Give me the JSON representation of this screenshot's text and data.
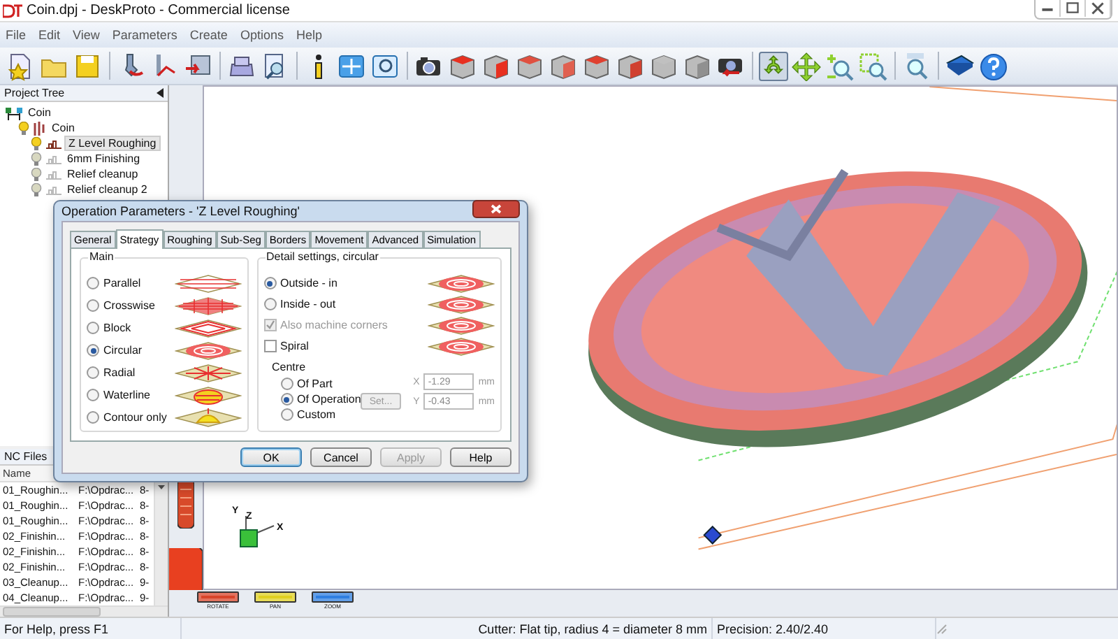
{
  "window": {
    "title": "Coin.dpj - DeskProto - Commercial license"
  },
  "menu": [
    "File",
    "Edit",
    "View",
    "Parameters",
    "Create",
    "Options",
    "Help"
  ],
  "project_tree": {
    "title": "Project Tree",
    "items": [
      {
        "label": "Coin",
        "kind": "project",
        "children": [
          {
            "label": "Coin",
            "kind": "part",
            "lit": true,
            "selected": false,
            "children": [
              {
                "label": "Z Level Roughing",
                "kind": "operation",
                "lit": true,
                "selected": true
              },
              {
                "label": "6mm Finishing",
                "kind": "operation",
                "lit": false,
                "selected": false
              },
              {
                "label": "Relief cleanup",
                "kind": "operation",
                "lit": false,
                "selected": false
              },
              {
                "label": "Relief cleanup 2",
                "kind": "operation",
                "lit": false,
                "selected": false
              }
            ]
          }
        ]
      }
    ]
  },
  "nc_files": {
    "title": "NC Files",
    "columns": [
      "Name"
    ],
    "rows": [
      [
        "01_Roughin...",
        "F:\\Opdrac...",
        "8-"
      ],
      [
        "01_Roughin...",
        "F:\\Opdrac...",
        "8-"
      ],
      [
        "01_Roughin...",
        "F:\\Opdrac...",
        "8-"
      ],
      [
        "02_Finishin...",
        "F:\\Opdrac...",
        "8-"
      ],
      [
        "02_Finishin...",
        "F:\\Opdrac...",
        "8-"
      ],
      [
        "02_Finishin...",
        "F:\\Opdrac...",
        "8-"
      ],
      [
        "03_Cleanup...",
        "F:\\Opdrac...",
        "9-"
      ],
      [
        "04_Cleanup...",
        "F:\\Opdrac...",
        "9-"
      ]
    ]
  },
  "viewport": {
    "axes": [
      "Y",
      "Z",
      "X"
    ],
    "wheels": [
      {
        "label": "ROTATE",
        "color": "#d8442a"
      },
      {
        "label": "PAN",
        "color": "#e0d020"
      },
      {
        "label": "ZOOM",
        "color": "#2f7fe0"
      }
    ]
  },
  "dialog": {
    "title": "Operation Parameters - 'Z Level Roughing'",
    "tabs": [
      {
        "label": "General",
        "selected": false
      },
      {
        "label": "Strategy",
        "selected": true
      },
      {
        "label": "Roughing",
        "selected": false
      },
      {
        "label": "Sub-Seg",
        "selected": false
      },
      {
        "label": "Borders",
        "selected": false
      },
      {
        "label": "Movement",
        "selected": false
      },
      {
        "label": "Advanced",
        "selected": false
      },
      {
        "label": "Simulation",
        "selected": false
      }
    ],
    "main": {
      "title": "Main",
      "options": [
        {
          "label": "Parallel",
          "kind": "parallel",
          "selected": false
        },
        {
          "label": "Crosswise",
          "kind": "crosswise",
          "selected": false
        },
        {
          "label": "Block",
          "kind": "block",
          "selected": false
        },
        {
          "label": "Circular",
          "kind": "circular",
          "selected": true
        },
        {
          "label": "Radial",
          "kind": "radial",
          "selected": false
        },
        {
          "label": "Waterline",
          "kind": "waterline",
          "selected": false
        },
        {
          "label": "Contour only",
          "kind": "contour",
          "selected": false
        }
      ]
    },
    "detail": {
      "title": "Detail settings, circular",
      "direction": [
        {
          "label": "Outside - in",
          "selected": true
        },
        {
          "label": "Inside - out",
          "selected": false
        }
      ],
      "corners": {
        "label": "Also machine corners",
        "checked": true,
        "disabled": true
      },
      "spiral": {
        "label": "Spiral",
        "checked": false,
        "disabled": false
      },
      "centre": {
        "title": "Centre",
        "options": [
          {
            "label": "Of Part",
            "selected": false
          },
          {
            "label": "Of Operation",
            "selected": true
          },
          {
            "label": "Custom",
            "selected": false
          }
        ],
        "set_button": {
          "label": "Set...",
          "disabled": true
        },
        "fields": [
          {
            "axis": "X",
            "value": "-1.29",
            "unit": "mm",
            "disabled": true
          },
          {
            "axis": "Y",
            "value": "-0.43",
            "unit": "mm",
            "disabled": true
          }
        ]
      }
    },
    "buttons": [
      {
        "label": "OK",
        "default": true,
        "disabled": false
      },
      {
        "label": "Cancel",
        "default": false,
        "disabled": false
      },
      {
        "label": "Apply",
        "default": false,
        "disabled": true
      },
      {
        "label": "Help",
        "default": false,
        "disabled": false
      }
    ]
  },
  "status_bar": [
    "For Help, press F1",
    "Cutter: Flat tip, radius 4 = diameter 8 mm",
    "Precision: 2.40/2.40"
  ]
}
